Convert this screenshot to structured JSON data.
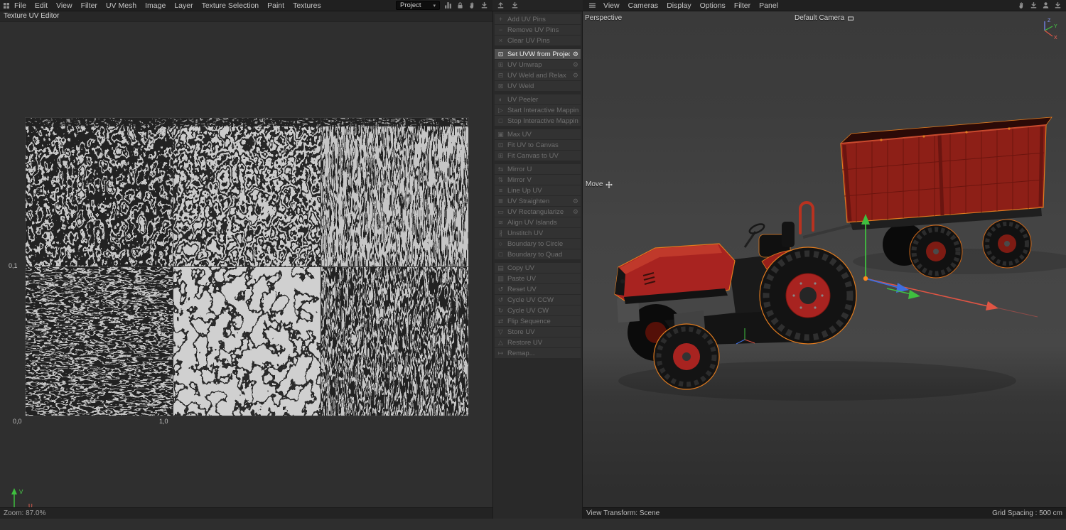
{
  "colors": {
    "selection_orange": "#e07b1f",
    "tractor_red": "#a82320",
    "gizmo_green": "#3fbf3f",
    "gizmo_red": "#e05544",
    "gizmo_blue": "#3f6fe0"
  },
  "ui_icons": {
    "caret_down": "▾",
    "gear": "⚙",
    "toolbar_left": [
      "histogram-icon",
      "lock-icon",
      "pan-hand-icon",
      "import-icon"
    ],
    "toolbar_mid": [
      "import-up-icon",
      "import-down-icon"
    ],
    "toolbar_right": [
      "pan-hand-icon",
      "import-icon",
      "user-icon",
      "download-icon"
    ]
  },
  "uv_editor": {
    "menu": [
      "File",
      "Edit",
      "View",
      "Filter",
      "UV Mesh",
      "Image",
      "Layer",
      "Texture Selection",
      "Paint",
      "Textures"
    ],
    "project_selector": "Project",
    "panel_title": "Texture UV Editor",
    "coords": {
      "top_left": "0,1",
      "bottom_left": "0,0",
      "bottom_right": "1,0"
    },
    "axis": {
      "u": "U",
      "v": "V"
    },
    "status_zoom": "Zoom: 87.0%"
  },
  "uv_commands": {
    "items": [
      {
        "label": "Add UV Pins",
        "icon": "+"
      },
      {
        "label": "Remove UV Pins",
        "icon": "−"
      },
      {
        "label": "Clear UV Pins",
        "icon": "×"
      },
      {
        "label": "Set UVW from Projection",
        "icon": "⊡",
        "selected": true,
        "gear": true,
        "group_start": true
      },
      {
        "label": "UV Unwrap",
        "icon": "⊞",
        "gear": true
      },
      {
        "label": "UV Weld and Relax",
        "icon": "⊟",
        "gear": true
      },
      {
        "label": "UV Weld",
        "icon": "⊠"
      },
      {
        "label": "UV Peeler",
        "icon": "◐",
        "group_start": true
      },
      {
        "label": "Start Interactive Mapping",
        "icon": "▷"
      },
      {
        "label": "Stop Interactive Mapping",
        "icon": "□"
      },
      {
        "label": "Max UV",
        "icon": "▣",
        "group_start": true
      },
      {
        "label": "Fit UV to Canvas",
        "icon": "⊡"
      },
      {
        "label": "Fit Canvas to UV",
        "icon": "⊞"
      },
      {
        "label": "Mirror U",
        "icon": "⇆",
        "group_start": true
      },
      {
        "label": "Mirror V",
        "icon": "⇅"
      },
      {
        "label": "Line Up UV",
        "icon": "≡"
      },
      {
        "label": "UV Straighten",
        "icon": "≣",
        "gear": true
      },
      {
        "label": "UV Rectangularize",
        "icon": "▭",
        "gear": true
      },
      {
        "label": "Align UV Islands",
        "icon": "≋"
      },
      {
        "label": "Unstitch UV",
        "icon": "∦"
      },
      {
        "label": "Boundary to Circle",
        "icon": "○"
      },
      {
        "label": "Boundary to Quad",
        "icon": "□"
      },
      {
        "label": "Copy UV",
        "icon": "▤",
        "group_start": true
      },
      {
        "label": "Paste UV",
        "icon": "▥"
      },
      {
        "label": "Reset UV",
        "icon": "↺"
      },
      {
        "label": "Cycle UV CCW",
        "icon": "↺"
      },
      {
        "label": "Cycle UV CW",
        "icon": "↻"
      },
      {
        "label": "Flip Sequence",
        "icon": "⇄"
      },
      {
        "label": "Store UV",
        "icon": "▽"
      },
      {
        "label": "Restore UV",
        "icon": "△"
      },
      {
        "label": "Remap...",
        "icon": "↦"
      }
    ]
  },
  "viewport": {
    "menu": [
      "View",
      "Cameras",
      "Display",
      "Options",
      "Filter",
      "Panel"
    ],
    "camera_mode": "Perspective",
    "camera_name": "Default Camera",
    "tool_label": "Move",
    "axis_hud": {
      "x": "X",
      "y": "Y",
      "z": "Z"
    },
    "status_left": "View Transform: Scene",
    "status_right": "Grid Spacing : 500 cm"
  }
}
